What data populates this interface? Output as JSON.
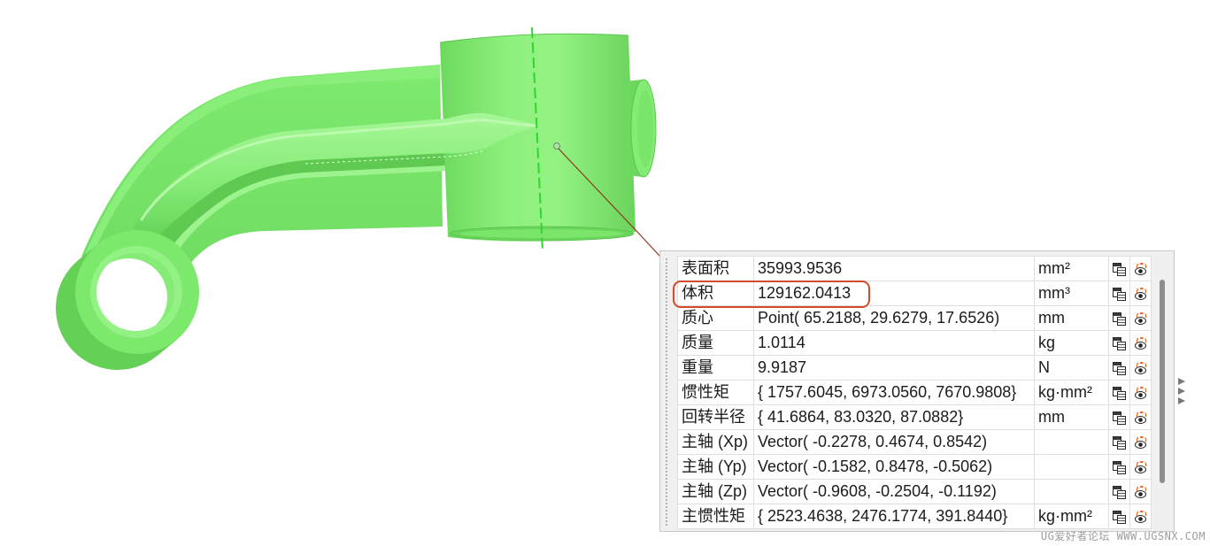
{
  "table": {
    "rows": [
      {
        "label": "表面积",
        "value": "35993.9536",
        "unit": "mm²"
      },
      {
        "label": "体积",
        "value": "129162.0413",
        "unit": "mm³"
      },
      {
        "label": "质心",
        "value": "Point( 65.2188, 29.6279, 17.6526)",
        "unit": "mm"
      },
      {
        "label": "质量",
        "value": "1.0114",
        "unit": "kg"
      },
      {
        "label": "重量",
        "value": "9.9187",
        "unit": "N"
      },
      {
        "label": "惯性矩",
        "value": "{ 1757.6045, 6973.0560, 7670.9808}",
        "unit": "kg·mm²"
      },
      {
        "label": "回转半径",
        "value": "{ 41.6864, 83.0320, 87.0882}",
        "unit": "mm"
      },
      {
        "label": "主轴 (Xp)",
        "value": "Vector( -0.2278, 0.4674, 0.8542)",
        "unit": ""
      },
      {
        "label": "主轴 (Yp)",
        "value": "Vector( -0.1582, 0.8478, -0.5062)",
        "unit": ""
      },
      {
        "label": "主轴 (Zp)",
        "value": "Vector( -0.9608, -0.2504, -0.1192)",
        "unit": ""
      },
      {
        "label": "主惯性矩",
        "value": "{ 2523.4638, 2476.1774, 391.8440}",
        "unit": "kg·mm²"
      }
    ],
    "highlighted_row": 1,
    "row_icons": [
      "copy-icon",
      "eye-icon"
    ]
  },
  "icons": {
    "panel_side_arrows": "chevron-right-icon"
  },
  "watermark": "UG爱好者论坛 WWW.UGSNX.COM",
  "colors": {
    "part_green": "#76e266",
    "axis_line": "#2fd62f",
    "leader_line": "#8b3a1a",
    "highlight_box": "#d8492b",
    "panel_background": "#f0f0f0",
    "grid_line": "#dedede"
  }
}
